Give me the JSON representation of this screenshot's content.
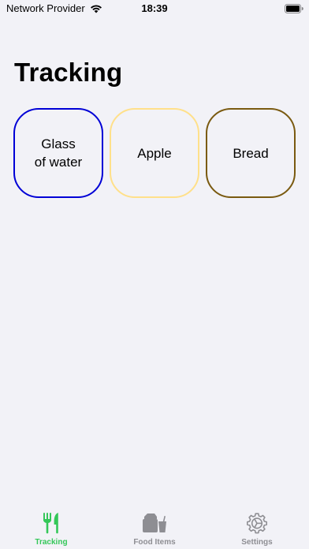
{
  "status_bar": {
    "carrier": "Network Provider",
    "time": "18:39",
    "wifi_icon": "wifi-icon",
    "battery_icon": "battery-icon"
  },
  "page": {
    "title": "Tracking"
  },
  "cards": [
    {
      "label": "Glass\nof water",
      "border_color": "#0000d6"
    },
    {
      "label": "Apple",
      "border_color": "#ffe08a"
    },
    {
      "label": "Bread",
      "border_color": "#7a5a10"
    }
  ],
  "tab_bar": {
    "active_color": "#34c759",
    "inactive_color": "#8e8e93",
    "tabs": [
      {
        "label": "Tracking",
        "icon": "fork-knife-icon",
        "selected": true
      },
      {
        "label": "Food Items",
        "icon": "grocery-bag-icon",
        "selected": false
      },
      {
        "label": "Settings",
        "icon": "gear-icon",
        "selected": false
      }
    ]
  }
}
